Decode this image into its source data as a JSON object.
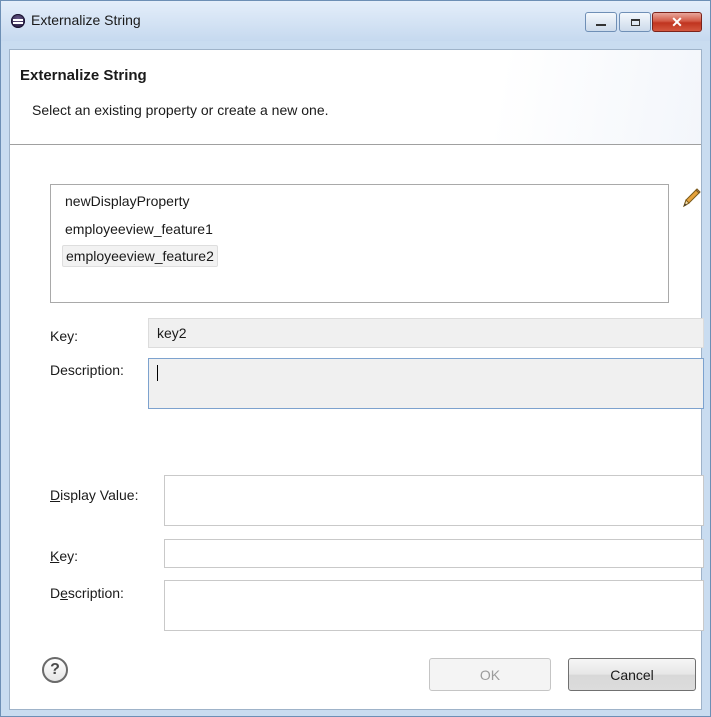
{
  "window": {
    "title": "Externalize String",
    "icon": "eclipse-icon"
  },
  "banner": {
    "title": "Externalize String",
    "message": "Select an existing property or create a new one."
  },
  "properties": {
    "items": [
      {
        "label": "newDisplayProperty",
        "selected": false
      },
      {
        "label": "employeeview_feature1",
        "selected": false
      },
      {
        "label": "employeeview_feature2",
        "selected": true
      }
    ],
    "edit_icon": "pencil-icon"
  },
  "selected_property": {
    "key_label": "Key:",
    "key_value": "key2",
    "description_label": "Description:",
    "description_value": ""
  },
  "new_property": {
    "display_value_label_mnemonic": "D",
    "display_value_label_rest": "isplay Value:",
    "display_value": "",
    "key_label_mnemonic": "K",
    "key_label_rest": "ey:",
    "key_value": "",
    "description_label_pre": "D",
    "description_label_mnemonic": "e",
    "description_label_rest": "scription:",
    "description_value": ""
  },
  "footer": {
    "help_icon": "help-icon",
    "help_glyph": "?",
    "ok_label": "OK",
    "ok_enabled": false,
    "cancel_label": "Cancel"
  }
}
